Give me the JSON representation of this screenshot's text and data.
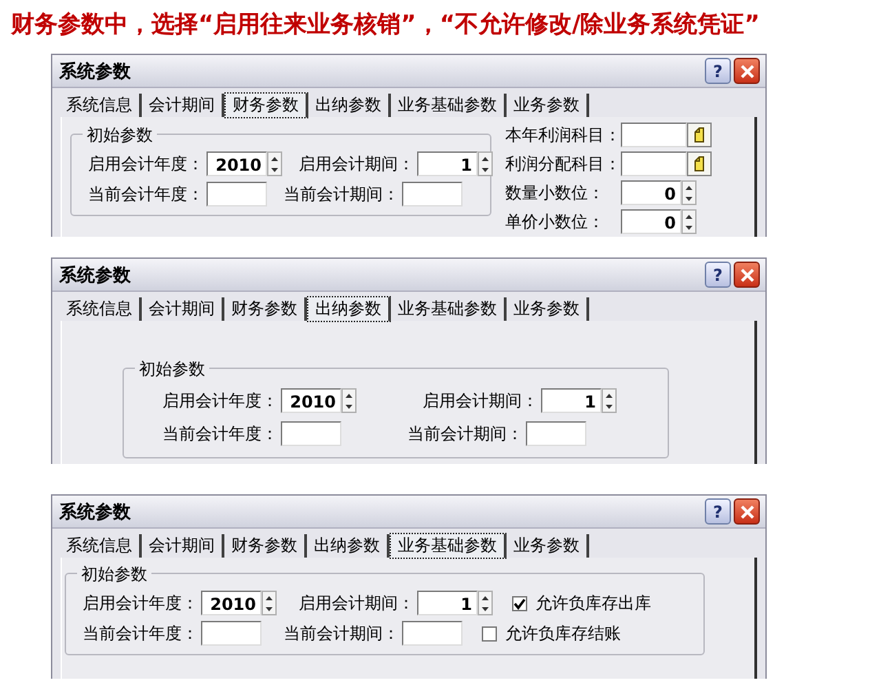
{
  "heading": "财务参数中，选择“启用往来业务核销”，“不允许修改/除业务系统凭证”",
  "dialogs": [
    {
      "title": "系统参数",
      "help_button": "?",
      "tabs": [
        {
          "label": "系统信息",
          "selected": false
        },
        {
          "label": "会计期间",
          "selected": false
        },
        {
          "label": "财务参数",
          "selected": true
        },
        {
          "label": "出纳参数",
          "selected": false
        },
        {
          "label": "业务基础参数",
          "selected": false
        },
        {
          "label": "业务参数",
          "selected": false
        }
      ],
      "group": {
        "title": "初始参数",
        "rows": [
          [
            {
              "kind": "spin",
              "label": "启用会计年度：",
              "value": "2010"
            },
            {
              "kind": "spin",
              "label": "启用会计期间：",
              "value": "1"
            }
          ],
          [
            {
              "kind": "text",
              "label": "当前会计年度："
            },
            {
              "kind": "text",
              "label": "当前会计期间："
            }
          ]
        ]
      },
      "side_fields": [
        {
          "kind": "lookup",
          "label": "本年利润科目："
        },
        {
          "kind": "lookup",
          "label": "利润分配科目："
        },
        {
          "kind": "spin",
          "label": "数量小数位：",
          "value": "0"
        },
        {
          "kind": "spin",
          "label": "单价小数位：",
          "value": "0"
        }
      ]
    },
    {
      "title": "系统参数",
      "help_button": "?",
      "tabs": [
        {
          "label": "系统信息",
          "selected": false
        },
        {
          "label": "会计期间",
          "selected": false
        },
        {
          "label": "财务参数",
          "selected": false
        },
        {
          "label": "出纳参数",
          "selected": true
        },
        {
          "label": "业务基础参数",
          "selected": false
        },
        {
          "label": "业务参数",
          "selected": false
        }
      ],
      "group": {
        "title": "初始参数",
        "rows": [
          [
            {
              "kind": "spin",
              "label": "启用会计年度：",
              "value": "2010"
            },
            {
              "kind": "spin",
              "label": "启用会计期间：",
              "value": "1"
            }
          ],
          [
            {
              "kind": "text",
              "label": "当前会计年度："
            },
            {
              "kind": "text",
              "label": "当前会计期间："
            }
          ]
        ]
      }
    },
    {
      "title": "系统参数",
      "help_button": "?",
      "tabs": [
        {
          "label": "系统信息",
          "selected": false
        },
        {
          "label": "会计期间",
          "selected": false
        },
        {
          "label": "财务参数",
          "selected": false
        },
        {
          "label": "出纳参数",
          "selected": false
        },
        {
          "label": "业务基础参数",
          "selected": true
        },
        {
          "label": "业务参数",
          "selected": false
        }
      ],
      "group": {
        "title": "初始参数",
        "rows": [
          [
            {
              "kind": "spin",
              "label": "启用会计年度：",
              "value": "2010"
            },
            {
              "kind": "spin",
              "label": "启用会计期间：",
              "value": "1"
            },
            {
              "kind": "checkbox",
              "label": "允许负库存出库",
              "checked": true
            }
          ],
          [
            {
              "kind": "text",
              "label": "当前会计年度："
            },
            {
              "kind": "text",
              "label": "当前会计期间："
            },
            {
              "kind": "checkbox",
              "label": "允许负库存结账",
              "checked": false
            }
          ]
        ]
      }
    }
  ]
}
